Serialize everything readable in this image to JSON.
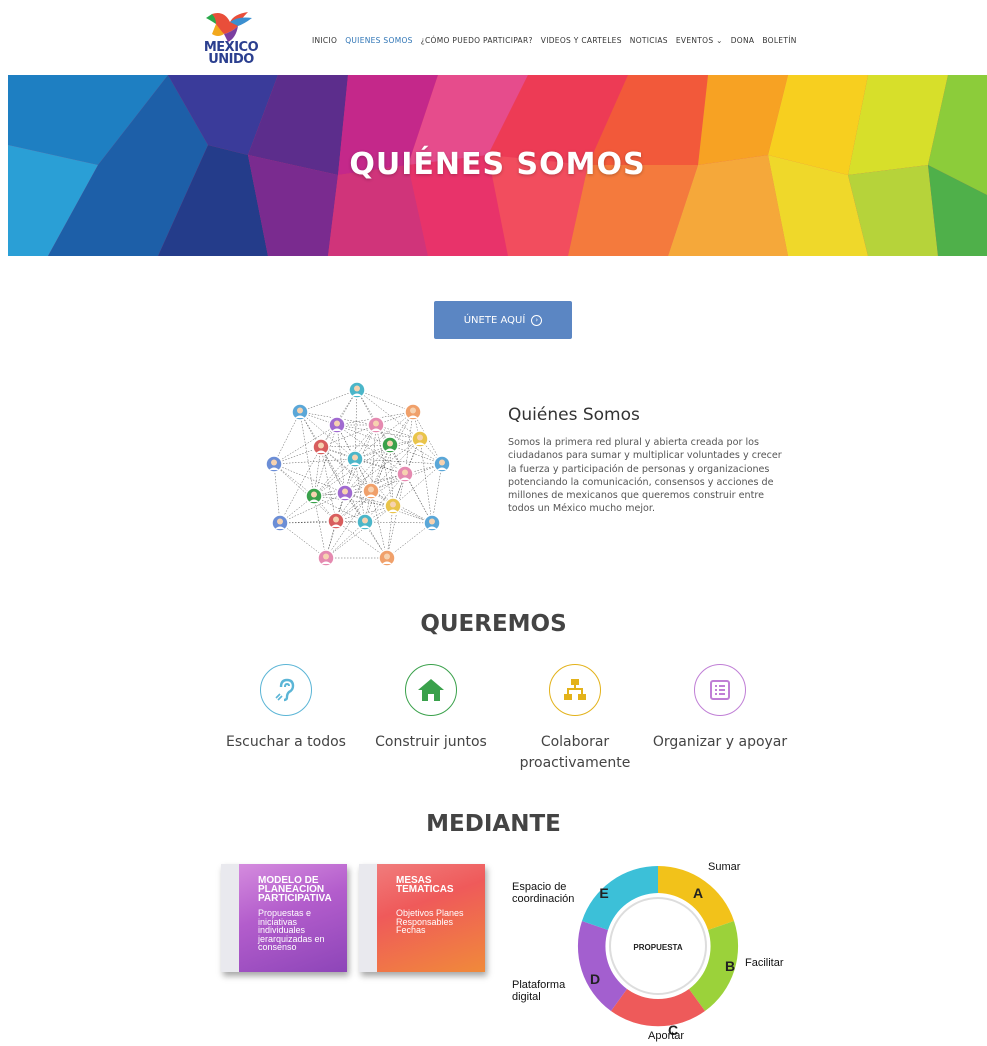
{
  "header": {
    "logo": {
      "line1": "MEXICO",
      "line2": "UNIDO"
    },
    "nav": [
      {
        "label": "INICIO",
        "active": false
      },
      {
        "label": "QUIENES SOMOS",
        "active": true
      },
      {
        "label": "¿CÓMO PUEDO PARTICIPAR?",
        "active": false
      },
      {
        "label": "VIDEOS Y CARTELES",
        "active": false
      },
      {
        "label": "NOTICIAS",
        "active": false
      },
      {
        "label": "EVENTOS ⌄",
        "active": false
      },
      {
        "label": "DONA",
        "active": false
      },
      {
        "label": "BOLETÍN",
        "active": false
      }
    ]
  },
  "hero": {
    "title": "QUIÉNES SOMOS"
  },
  "join_button": {
    "label": "ÚNETE AQUÍ",
    "icon": "arrow-circle-right-icon"
  },
  "about": {
    "title": "Quiénes Somos",
    "text": "Somos la primera red plural y abierta creada por los ciudadanos para sumar y multiplicar voluntades y crecer la fuerza y participación de personas y organizaciones potenciando la comunicación, consensos y acciones de millones de mexicanos que queremos construir entre todos un México mucho mejor."
  },
  "queremos": {
    "title": "QUEREMOS",
    "items": [
      {
        "label": "Escuchar a todos",
        "icon": "hearing-icon",
        "color": "#5bb5d6"
      },
      {
        "label": "Construir juntos",
        "icon": "home-icon",
        "color": "#3aa14b"
      },
      {
        "label": "Colaborar proactivamente",
        "icon": "network-icon",
        "color": "#e3b21a"
      },
      {
        "label": "Organizar y apoyar",
        "icon": "list-icon",
        "color": "#c07fd6"
      }
    ]
  },
  "mediante": {
    "title": "MEDIANTE",
    "cards": [
      {
        "title": "MODELO DE PLANEACION PARTICIPATIVA",
        "body": "Propuestas e iniciativas individuales jerarquizadas en consenso"
      },
      {
        "title": "MESAS TEMATICAS",
        "body": "Objetivos Planes Responsables Fechas"
      }
    ],
    "cycle": {
      "center": "PROPUESTA",
      "labels": [
        {
          "letter": "A",
          "text": "Sumar"
        },
        {
          "letter": "B",
          "text": "Facilitar"
        },
        {
          "letter": "C",
          "text": "Aportar"
        },
        {
          "letter": "D",
          "text": "Plataforma digital"
        },
        {
          "letter": "E",
          "text": "Espacio de coordinación"
        }
      ]
    }
  }
}
